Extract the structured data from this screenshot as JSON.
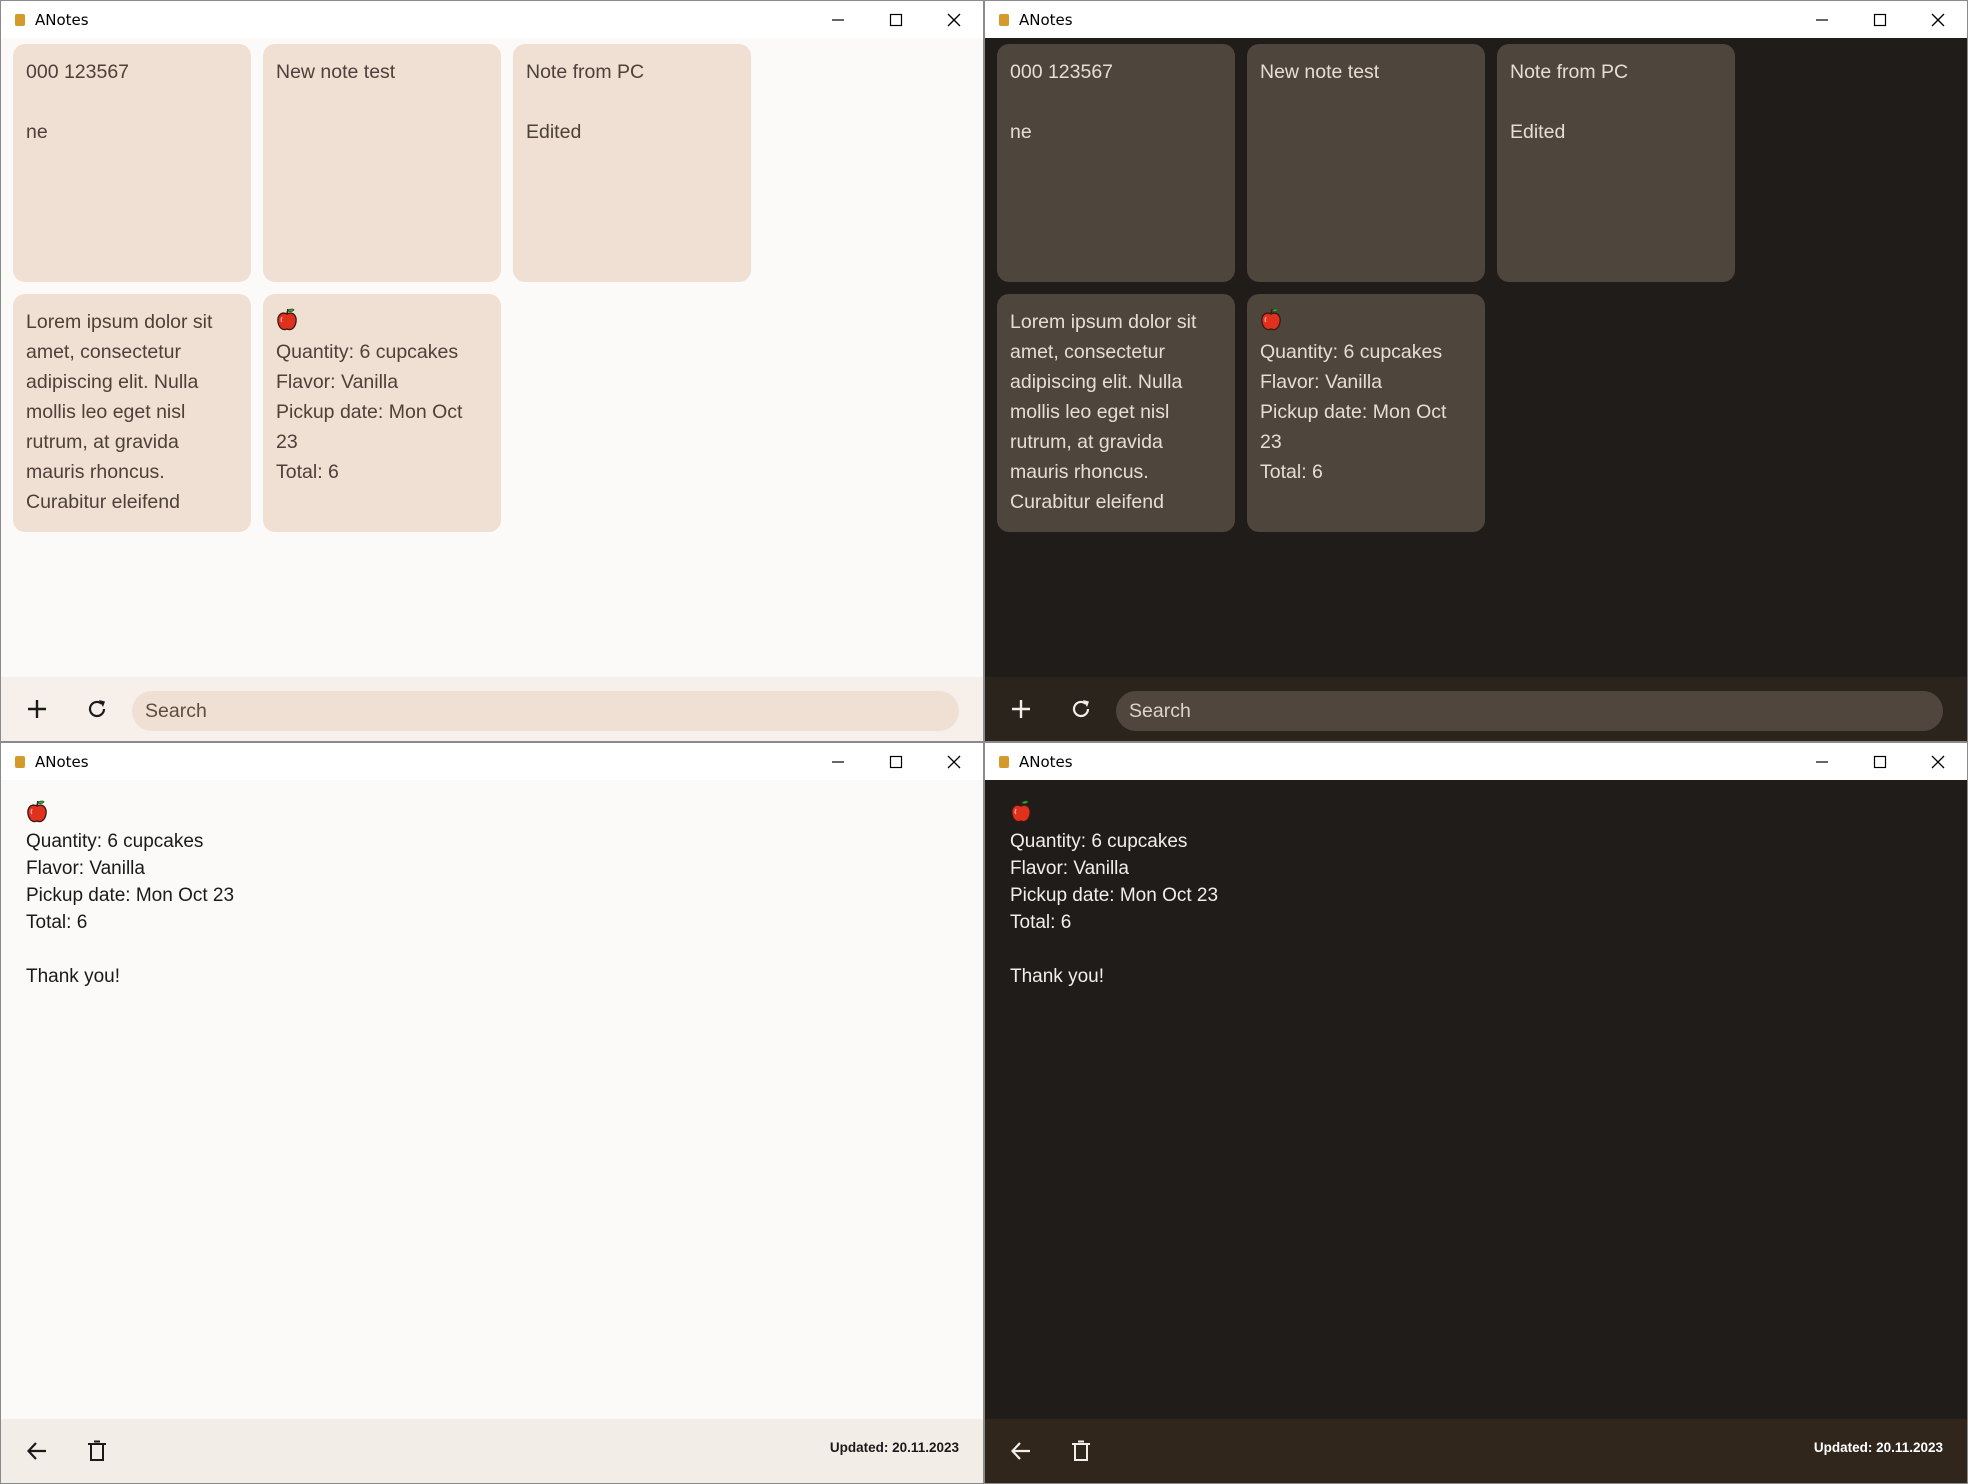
{
  "app": {
    "title": "ANotes"
  },
  "notes": [
    {
      "text": "000 123567\n\nne"
    },
    {
      "text": "New note test"
    },
    {
      "text": "Note from PC\n\nEdited"
    },
    {
      "text": "Lorem ipsum dolor sit amet, consectetur adipiscing elit. Nulla mollis leo eget nisl rutrum, at gravida mauris rhoncus. Curabitur eleifend"
    },
    {
      "icon": "apple-icon",
      "text": "Quantity: 6 cupcakes\nFlavor: Vanilla\nPickup date: Mon Oct 23\nTotal: 6"
    }
  ],
  "list_toolbar": {
    "add_icon": "plus-icon",
    "refresh_icon": "refresh-icon",
    "search_placeholder": "Search"
  },
  "detail": {
    "icon": "apple-icon",
    "body": "Quantity: 6 cupcakes\nFlavor: Vanilla\nPickup date: Mon Oct 23\nTotal: 6\n\nThank you!",
    "updated": "Updated: 20.11.2023",
    "back_icon": "arrow-left-icon",
    "delete_icon": "trash-icon"
  },
  "themes": {
    "light": {
      "background": "#fcfaf9",
      "card": "#f0e0d3",
      "text": "#4d4039"
    },
    "dark": {
      "background": "#1f1c19",
      "card": "#4e453d",
      "text": "#e7ddd5"
    }
  }
}
